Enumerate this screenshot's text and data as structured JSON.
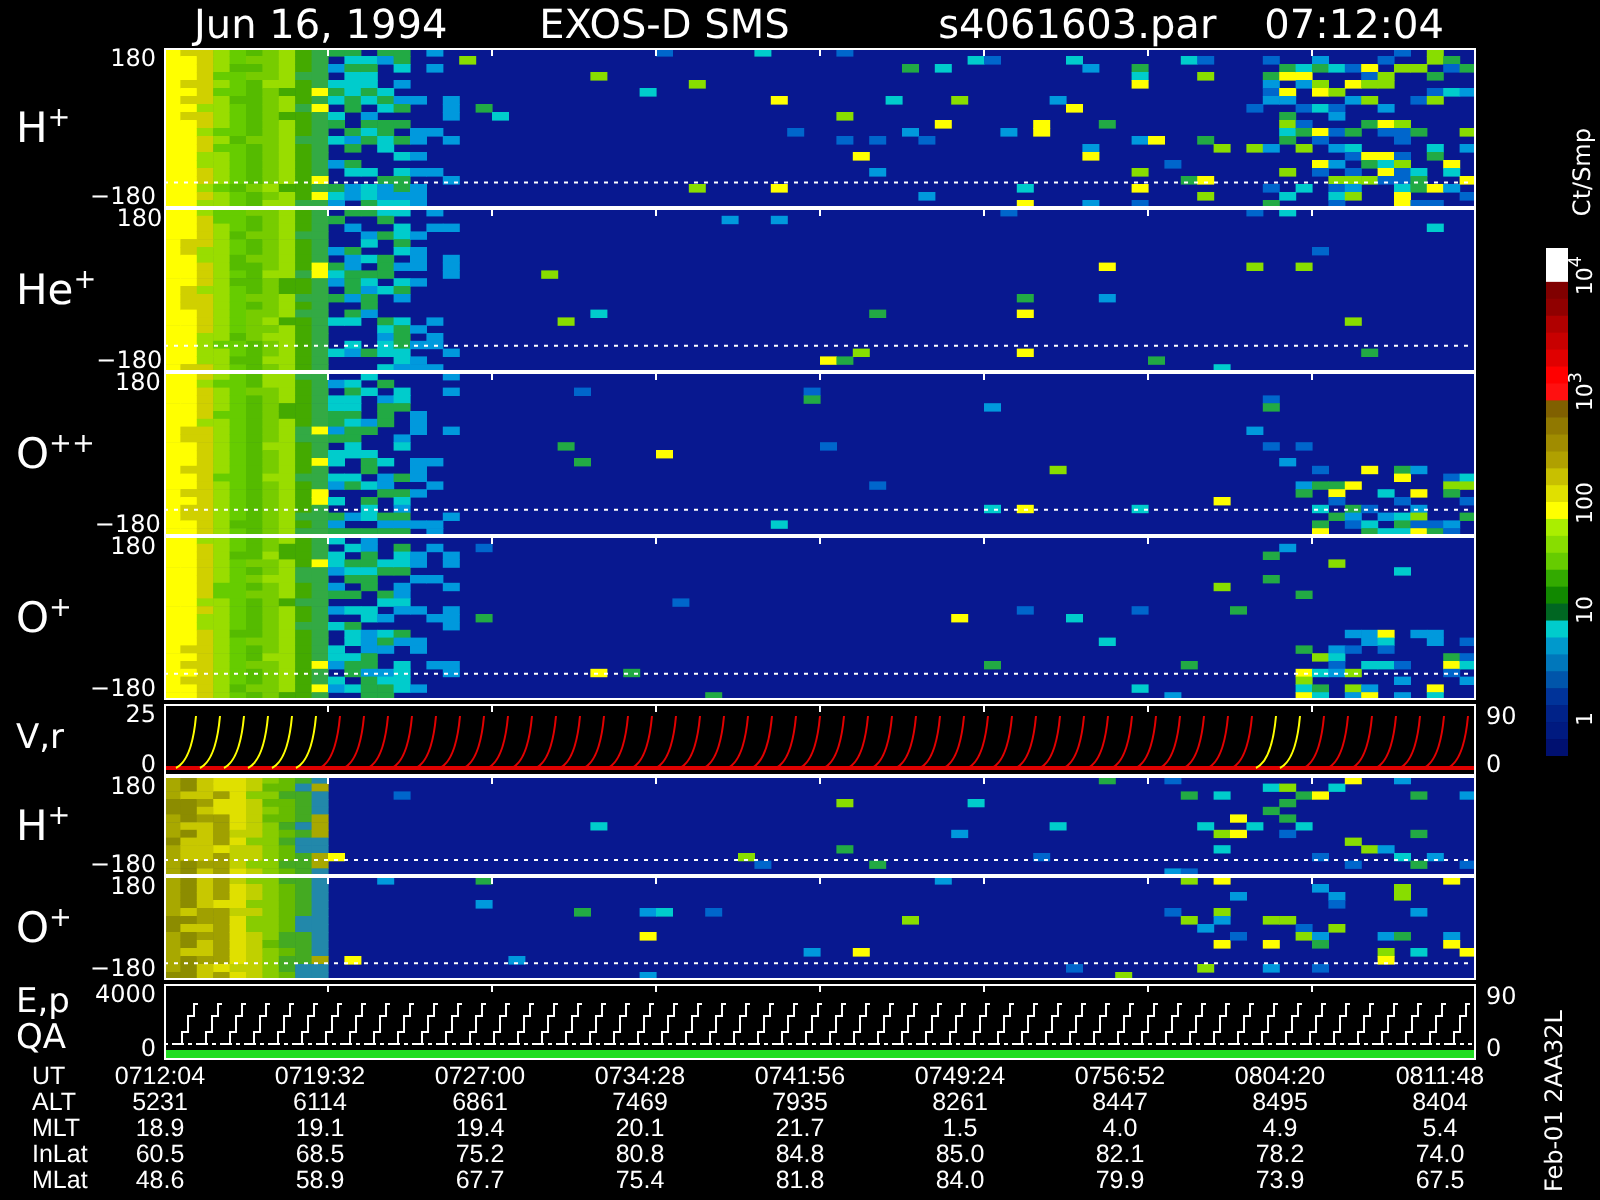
{
  "header": {
    "date": "Jun 16, 1994",
    "title": "EXOS-D SMS",
    "file": "s4061603.par",
    "time": "07:12:04"
  },
  "panels": [
    {
      "kind": "spectrogram",
      "labels": [
        "H$^{+}$"
      ],
      "ticks": [
        "180",
        "−180"
      ]
    },
    {
      "kind": "spectrogram",
      "labels": [
        "He$^{+}$"
      ],
      "ticks": [
        "180",
        "−180"
      ]
    },
    {
      "kind": "spectrogram",
      "labels": [
        "O$^{++}$"
      ],
      "ticks": [
        "180",
        "−180"
      ]
    },
    {
      "kind": "spectrogram",
      "labels": [
        "O$^{+}$"
      ],
      "ticks": [
        "180",
        "−180"
      ]
    },
    {
      "kind": "velocity",
      "labels": [
        "V,r"
      ],
      "ticks": [
        "25",
        "0"
      ],
      "right_ticks": [
        "90",
        "0"
      ]
    },
    {
      "kind": "spectrogram",
      "labels": [
        "H$^{+}$"
      ],
      "ticks": [
        "180",
        "−180"
      ]
    },
    {
      "kind": "spectrogram",
      "labels": [
        "O$^{+}$"
      ],
      "ticks": [
        "180",
        "−180"
      ]
    },
    {
      "kind": "energy",
      "labels": [
        "E,p",
        "QA"
      ],
      "ticks": [
        "4000",
        "0"
      ],
      "right_ticks": [
        "90",
        "0"
      ]
    }
  ],
  "table": {
    "rows": [
      {
        "label": "UT",
        "values": [
          "0712:04",
          "0719:32",
          "0727:00",
          "0734:28",
          "0741:56",
          "0749:24",
          "0756:52",
          "0804:20",
          "0811:48"
        ]
      },
      {
        "label": "ALT",
        "values": [
          "5231",
          "6114",
          "6861",
          "7469",
          "7935",
          "8261",
          "8447",
          "8495",
          "8404"
        ]
      },
      {
        "label": "MLT",
        "values": [
          "18.9",
          "19.1",
          "19.4",
          "20.1",
          "21.7",
          "1.5",
          "4.0",
          "4.9",
          "5.4"
        ]
      },
      {
        "label": "InLat",
        "values": [
          "60.5",
          "68.5",
          "75.2",
          "80.8",
          "84.8",
          "85.0",
          "82.1",
          "78.2",
          "74.0"
        ]
      },
      {
        "label": "MLat",
        "values": [
          "48.6",
          "58.9",
          "67.7",
          "75.4",
          "81.8",
          "84.0",
          "79.9",
          "73.9",
          "67.5"
        ]
      }
    ]
  },
  "color_scale": {
    "title": "Ct/Smp",
    "labels": [
      "10$^{4}$",
      "10$^{3}$",
      "100",
      "10",
      "1"
    ]
  },
  "footer": "Feb-01 2AA32L"
}
